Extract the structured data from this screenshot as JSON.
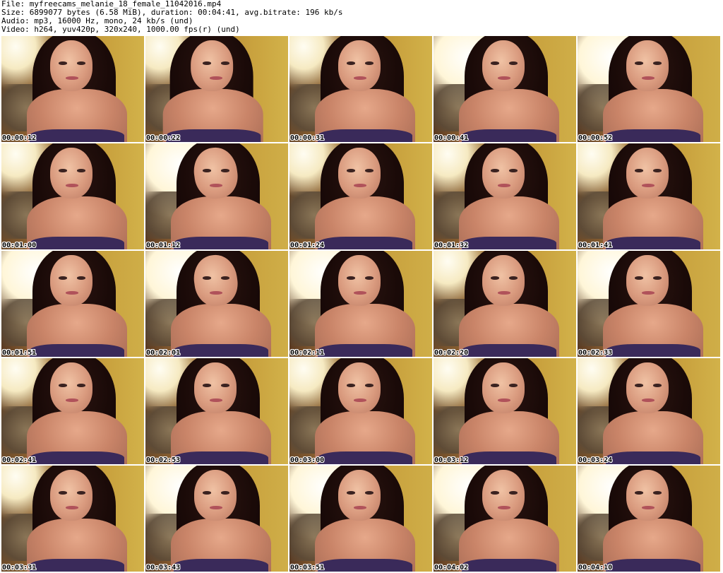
{
  "header": {
    "file_line": "File: myfreecams_melanie_18_female_11042016.mp4",
    "size_line": "Size: 6899077 bytes (6.58 MiB), duration: 00:04:41, avg.bitrate: 196 kb/s",
    "audio_line": "Audio: mp3, 16000 Hz, mono, 24 kb/s (und)",
    "video_line": "Video: h264, yuv420p, 320x240, 1000.00 fps(r) (und)"
  },
  "thumbnails": [
    {
      "timestamp": "00:00:12"
    },
    {
      "timestamp": "00:00:22"
    },
    {
      "timestamp": "00:00:31"
    },
    {
      "timestamp": "00:00:41"
    },
    {
      "timestamp": "00:00:52"
    },
    {
      "timestamp": "00:01:00"
    },
    {
      "timestamp": "00:01:12"
    },
    {
      "timestamp": "00:01:24"
    },
    {
      "timestamp": "00:01:32"
    },
    {
      "timestamp": "00:01:41"
    },
    {
      "timestamp": "00:01:51"
    },
    {
      "timestamp": "00:02:01"
    },
    {
      "timestamp": "00:02:11"
    },
    {
      "timestamp": "00:02:20"
    },
    {
      "timestamp": "00:02:33"
    },
    {
      "timestamp": "00:02:41"
    },
    {
      "timestamp": "00:02:53"
    },
    {
      "timestamp": "00:03:00"
    },
    {
      "timestamp": "00:03:12"
    },
    {
      "timestamp": "00:03:24"
    },
    {
      "timestamp": "00:03:31"
    },
    {
      "timestamp": "00:03:43"
    },
    {
      "timestamp": "00:03:51"
    },
    {
      "timestamp": "00:04:02"
    },
    {
      "timestamp": "00:04:10"
    }
  ]
}
